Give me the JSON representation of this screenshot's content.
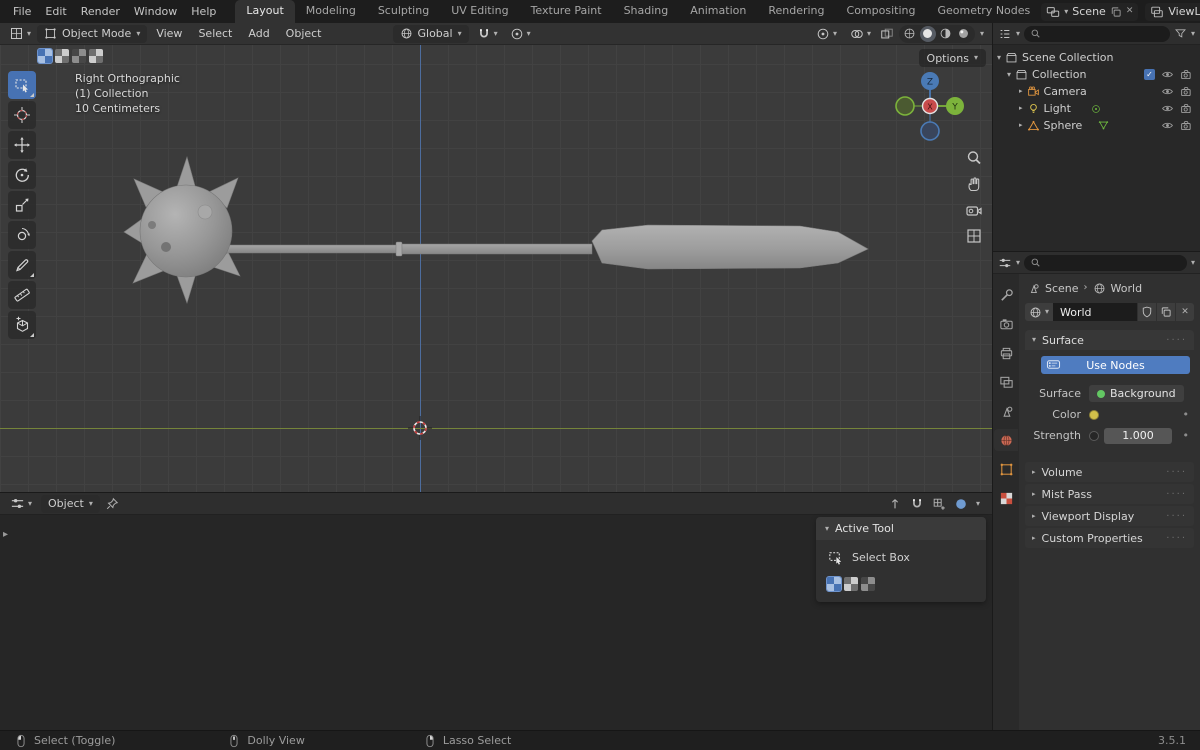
{
  "glyphs": {
    "down": "▾",
    "right": "▸",
    "sep": "›",
    "close": "✕",
    "check": "✓",
    "dot": "•",
    "grip": "····"
  },
  "topbar": {
    "menus": [
      {
        "label": "File"
      },
      {
        "label": "Edit"
      },
      {
        "label": "Render"
      },
      {
        "label": "Window"
      },
      {
        "label": "Help"
      }
    ],
    "workspaces": [
      {
        "label": "Layout"
      },
      {
        "label": "Modeling"
      },
      {
        "label": "Sculpting"
      },
      {
        "label": "UV Editing"
      },
      {
        "label": "Texture Paint"
      },
      {
        "label": "Shading"
      },
      {
        "label": "Animation"
      },
      {
        "label": "Rendering"
      },
      {
        "label": "Compositing"
      },
      {
        "label": "Geometry Nodes"
      }
    ],
    "active_workspace": "Layout",
    "scene_label": "Scene",
    "viewlayer_label": "ViewLayer"
  },
  "viewport_header": {
    "mode": "Object Mode",
    "menus": [
      {
        "label": "View"
      },
      {
        "label": "Select"
      },
      {
        "label": "Add"
      },
      {
        "label": "Object"
      }
    ],
    "orientation": "Global",
    "options_label": "Options"
  },
  "viewport": {
    "overlay": {
      "line1": "Right Orthographic",
      "line2": "(1) Collection",
      "line3": "10 Centimeters"
    },
    "gizmo": {
      "x_label": "X",
      "y_label": "Y",
      "z_label": "Z"
    }
  },
  "outliner": {
    "scene_collection": "Scene Collection",
    "collection": "Collection",
    "objects": [
      {
        "label": "Camera"
      },
      {
        "label": "Light"
      },
      {
        "label": "Sphere"
      }
    ]
  },
  "properties": {
    "breadcrumb": {
      "scene": "Scene",
      "world": "World"
    },
    "world_name": "World",
    "surface": {
      "title": "Surface",
      "use_nodes": "Use Nodes",
      "surface_label": "Surface",
      "surface_value": "Background",
      "color_label": "Color",
      "strength_label": "Strength",
      "strength_value": "1.000"
    },
    "collapsed": [
      {
        "label": "Volume"
      },
      {
        "label": "Mist Pass"
      },
      {
        "label": "Viewport Display"
      },
      {
        "label": "Custom Properties"
      }
    ]
  },
  "bottom_editor": {
    "mode": "Object",
    "tool_panel": {
      "title": "Active Tool",
      "tool_name": "Select Box"
    }
  },
  "statusbar": {
    "items": [
      {
        "label": "Select (Toggle)"
      },
      {
        "label": "Dolly View"
      },
      {
        "label": "Lasso Select"
      }
    ],
    "version": "3.5.1"
  },
  "colors": {
    "accent": "#4772b3",
    "object_orange": "#e0953f",
    "data_green": "#6fbb3f",
    "axis_x": "#c84b4b",
    "axis_y": "#7cb33b",
    "axis_z": "#4a7ab5",
    "use_nodes_blue": "#4f7cc0"
  }
}
